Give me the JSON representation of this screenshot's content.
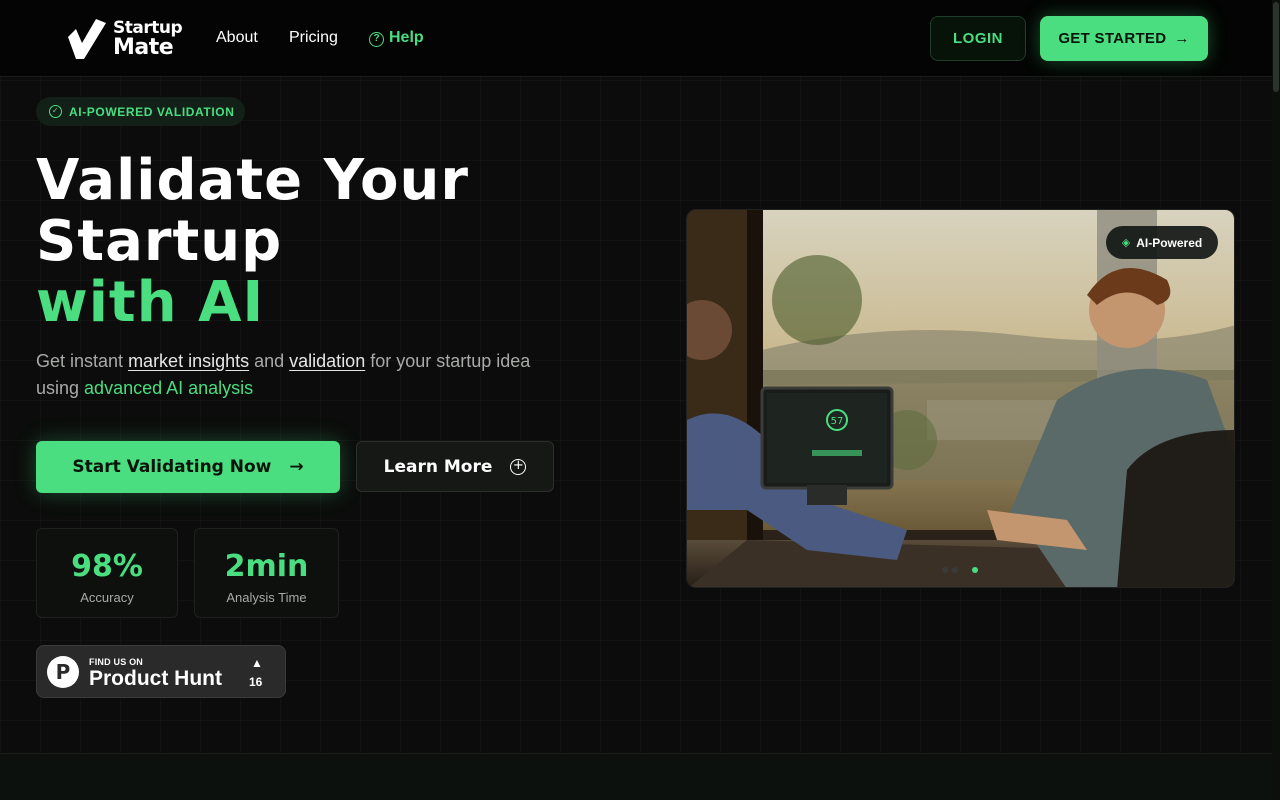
{
  "header": {
    "logo_line1": "Startup",
    "logo_line2": "Mate",
    "nav": [
      {
        "label": "About"
      },
      {
        "label": "Pricing"
      },
      {
        "label": "Help"
      }
    ],
    "login_label": "LOGIN",
    "get_started_label": "GET STARTED"
  },
  "hero": {
    "badge": "AI-POWERED VALIDATION",
    "headline_line1": "Validate Your",
    "headline_line2": "Startup",
    "headline_line3": "with AI",
    "subtitle": {
      "part1": "Get instant ",
      "link1": "market insights",
      "part2": " and ",
      "link2": "validation",
      "part3": " for your startup idea using ",
      "highlight": "advanced AI analysis"
    },
    "primary_button": "Start Validating Now",
    "secondary_button": "Learn More",
    "stats": [
      {
        "value": "98%",
        "label": "Accuracy"
      },
      {
        "value": "2min",
        "label": "Analysis Time"
      }
    ],
    "product_hunt": {
      "small": "FIND US ON",
      "name": "Product Hunt",
      "count": "16"
    },
    "image_pill": "AI-Powered",
    "screen_score": "57"
  },
  "colors": {
    "accent": "#4ade80",
    "background": "#0b0c0b"
  }
}
